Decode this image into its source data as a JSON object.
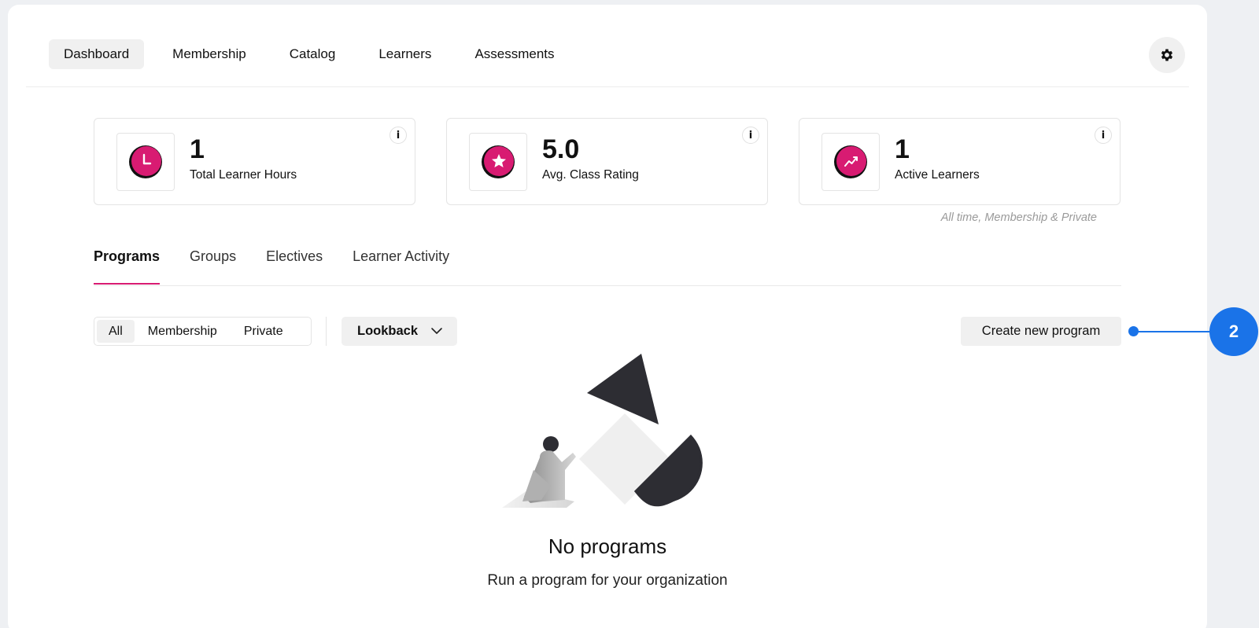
{
  "nav": {
    "items": [
      {
        "label": "Dashboard",
        "active": true
      },
      {
        "label": "Membership",
        "active": false
      },
      {
        "label": "Catalog",
        "active": false
      },
      {
        "label": "Learners",
        "active": false
      },
      {
        "label": "Assessments",
        "active": false
      }
    ],
    "settings_icon": "gear-icon"
  },
  "stats": [
    {
      "value": "1",
      "label": "Total Learner Hours",
      "icon": "clock-icon",
      "info": "i"
    },
    {
      "value": "5.0",
      "label": "Avg. Class Rating",
      "icon": "star-icon",
      "info": "i"
    },
    {
      "value": "1",
      "label": "Active Learners",
      "icon": "trend-up-icon",
      "info": "i"
    }
  ],
  "stats_caption": "All time, Membership & Private",
  "tabs": [
    {
      "label": "Programs",
      "active": true
    },
    {
      "label": "Groups",
      "active": false
    },
    {
      "label": "Electives",
      "active": false
    },
    {
      "label": "Learner Activity",
      "active": false
    }
  ],
  "filters": {
    "segments": [
      {
        "label": "All",
        "active": true
      },
      {
        "label": "Membership",
        "active": false
      },
      {
        "label": "Private",
        "active": false
      }
    ],
    "lookback_label": "Lookback"
  },
  "create_button_label": "Create new program",
  "callout_number": "2",
  "empty_state": {
    "title": "No programs",
    "subtitle": "Run a program for your organization"
  },
  "colors": {
    "accent": "#d81b72",
    "callout": "#1a73e8",
    "dark_shape": "#2d2d33"
  }
}
